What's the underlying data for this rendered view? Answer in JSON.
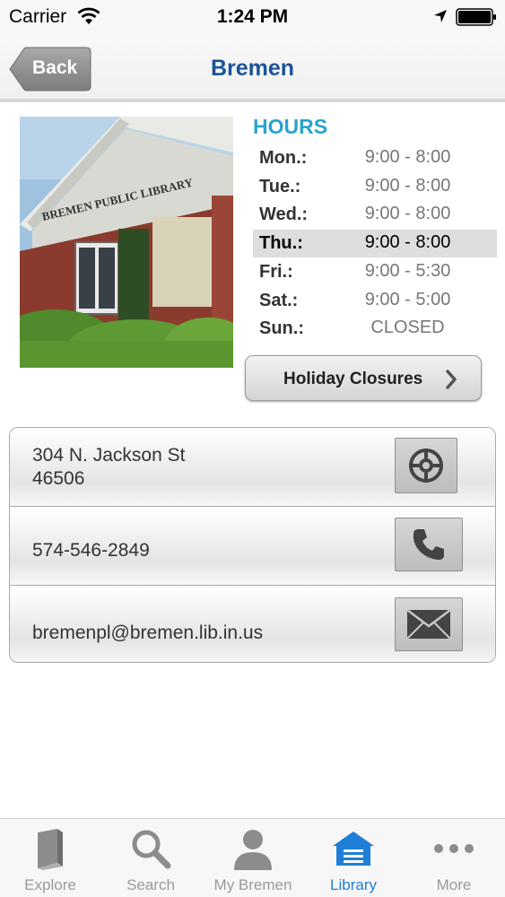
{
  "status_bar": {
    "carrier": "Carrier",
    "time": "1:24 PM",
    "icons": [
      "wifi-icon",
      "location-icon",
      "battery-icon"
    ]
  },
  "nav": {
    "back_label": "Back",
    "title": "Bremen"
  },
  "photo": {
    "sign_text": "BREMEN PUBLIC LIBRARY"
  },
  "hours": {
    "heading": "HOURS",
    "rows": [
      {
        "day": "Mon.:",
        "time": "9:00 - 8:00"
      },
      {
        "day": "Tue.:",
        "time": "9:00 - 8:00"
      },
      {
        "day": "Wed.:",
        "time": "9:00 - 8:00"
      },
      {
        "day": "Thu.:",
        "time": "9:00 - 8:00"
      },
      {
        "day": "Fri.:",
        "time": "9:00 - 5:30"
      },
      {
        "day": "Sat.:",
        "time": "9:00 - 5:00"
      },
      {
        "day": "Sun.:",
        "time": "CLOSED"
      }
    ],
    "highlighted_day": "Thu.:"
  },
  "holiday_button": {
    "label": "Holiday Closures"
  },
  "contact": {
    "address_line1": "304 N. Jackson St",
    "address_line2": "46506",
    "phone": "574-546-2849",
    "email": "bremenpl@bremen.lib.in.us",
    "icons": [
      "location-target-icon",
      "phone-icon",
      "envelope-icon"
    ]
  },
  "tabs": [
    {
      "label": "Explore",
      "icon": "book-icon"
    },
    {
      "label": "Search",
      "icon": "magnifier-icon"
    },
    {
      "label": "My Bremen",
      "icon": "person-icon"
    },
    {
      "label": "Library",
      "icon": "library-building-icon",
      "active": true
    },
    {
      "label": "More",
      "icon": "more-dots-icon"
    }
  ],
  "colors": {
    "title_blue": "#1b5496",
    "hours_heading": "#2aa3cf",
    "tab_active": "#1f7fd6",
    "tab_inactive": "#9a9a9a"
  }
}
